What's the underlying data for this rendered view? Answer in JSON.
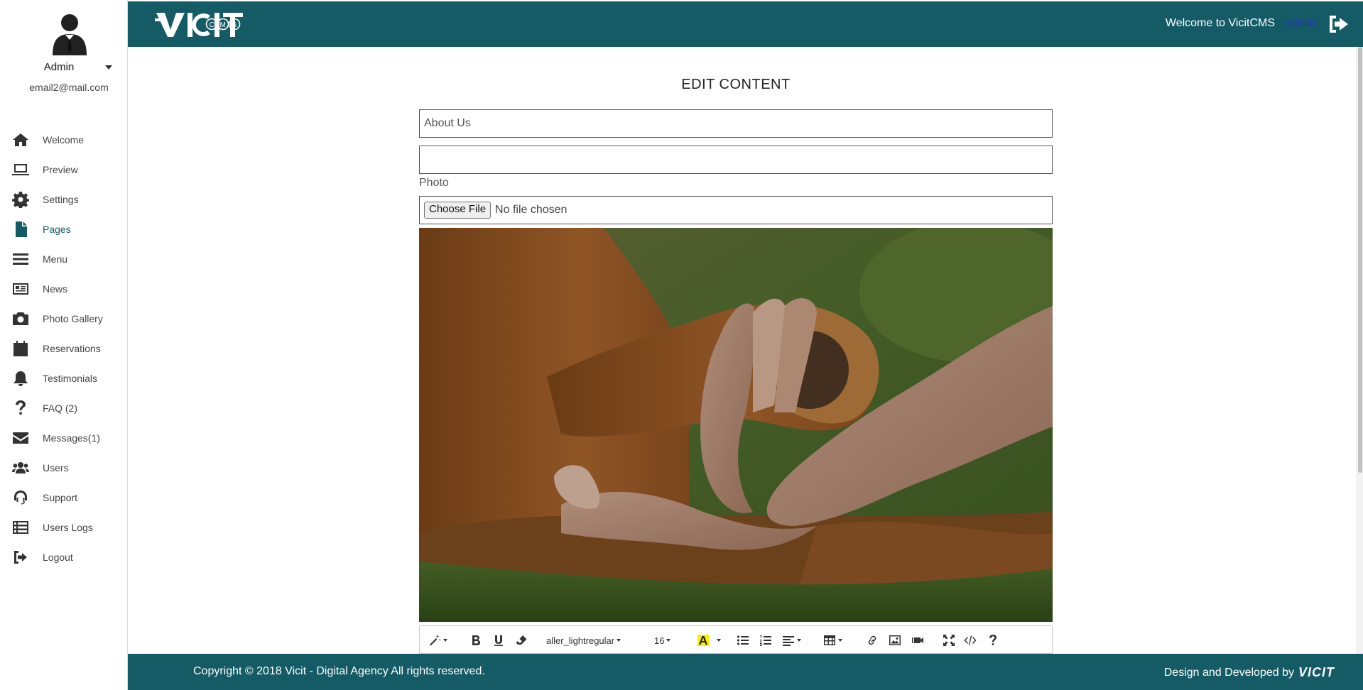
{
  "profile": {
    "name": "Admin",
    "email": "email2@mail.com"
  },
  "sidebar": {
    "items": [
      {
        "label": "Welcome",
        "icon": "home-icon"
      },
      {
        "label": "Preview",
        "icon": "laptop-icon"
      },
      {
        "label": "Settings",
        "icon": "gear-icon"
      },
      {
        "label": "Pages",
        "icon": "file-icon",
        "active": true
      },
      {
        "label": "Menu",
        "icon": "bars-icon"
      },
      {
        "label": "News",
        "icon": "newspaper-icon"
      },
      {
        "label": "Photo Gallery",
        "icon": "camera-icon"
      },
      {
        "label": "Reservations",
        "icon": "calendar-icon"
      },
      {
        "label": "Testimonials",
        "icon": "bell-icon"
      },
      {
        "label": "FAQ (2)",
        "icon": "question-icon"
      },
      {
        "label": "Messages(1)",
        "icon": "envelope-icon"
      },
      {
        "label": "Users",
        "icon": "users-icon"
      },
      {
        "label": "Support",
        "icon": "headset-icon"
      },
      {
        "label": "Users Logs",
        "icon": "list-icon"
      },
      {
        "label": "Logout",
        "icon": "sign-out-icon"
      }
    ]
  },
  "header": {
    "logo_text": "VICIT",
    "logo_sub": "CMS",
    "welcome": "Welcome to VicitCMS",
    "user_link": "admin",
    "accent": "#145b66"
  },
  "main": {
    "title": "EDIT CONTENT",
    "title_field_value": "About Us",
    "second_field_value": "",
    "photo_label": "Photo",
    "file_button": "Choose File",
    "file_status": "No file chosen"
  },
  "editor_toolbar": {
    "font_name": "aller_lightregular",
    "font_size": "16",
    "buttons": [
      "magic-icon",
      "bold-icon",
      "underline-icon",
      "eraser-icon",
      "font-color-icon",
      "unordered-list-icon",
      "ordered-list-icon",
      "align-icon",
      "table-icon",
      "link-icon",
      "picture-icon",
      "video-icon",
      "fullscreen-icon",
      "code-view-icon",
      "help-icon"
    ]
  },
  "footer": {
    "copyright": "Copyright © 2018 Vicit - Digital Agency All rights reserved.",
    "credit": "Design and Developed by",
    "credit_logo": "VICIT"
  }
}
